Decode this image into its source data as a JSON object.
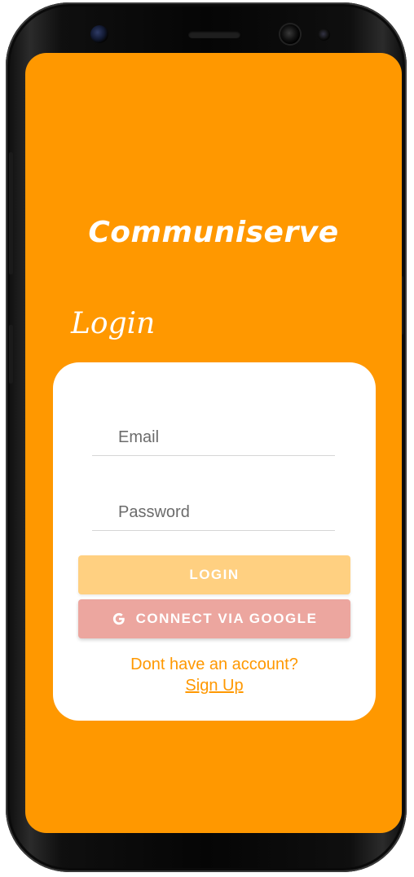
{
  "app": {
    "title": "Communiserve"
  },
  "login": {
    "heading": "Login"
  },
  "form": {
    "email_placeholder": "Email",
    "password_placeholder": "Password",
    "email_value": "",
    "password_value": ""
  },
  "buttons": {
    "login_label": "LOGIN",
    "google_label": "CONNECT VIA GOOGLE",
    "google_icon": "google-g-icon"
  },
  "footer": {
    "prompt": "Dont have an account?",
    "signup_label": "Sign Up"
  },
  "colors": {
    "background": "#ff9800",
    "card": "#ffffff",
    "login_button": "#ffd081",
    "google_button": "#eca69f",
    "accent_text": "#ff9800"
  }
}
